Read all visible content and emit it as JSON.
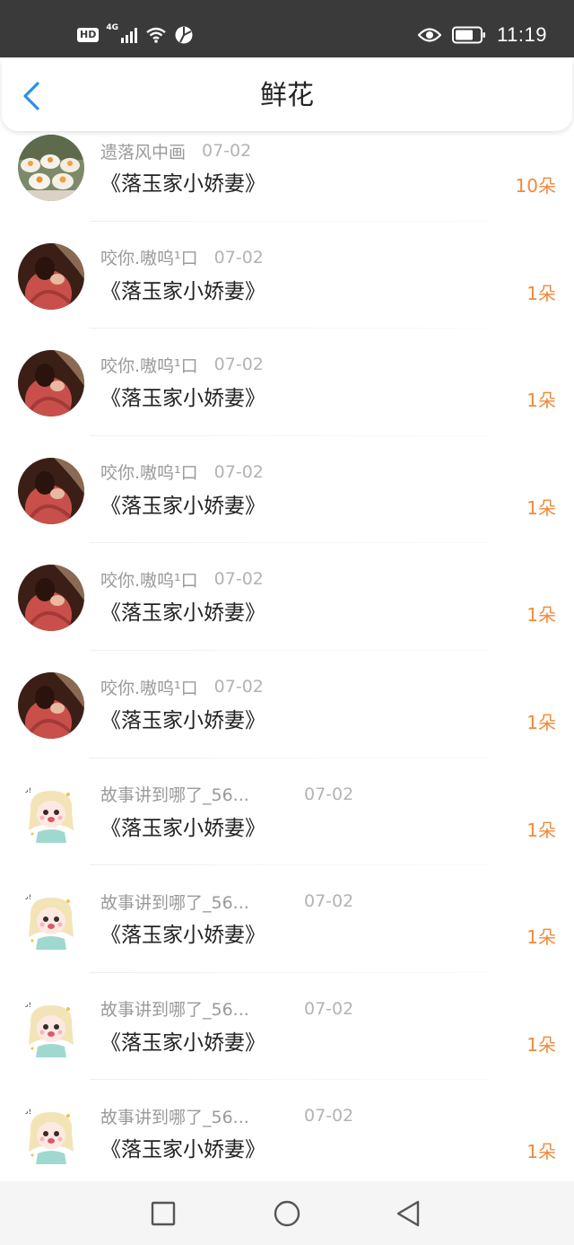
{
  "status_bar": {
    "hd": "HD",
    "network": "4G",
    "time": "11:19"
  },
  "header": {
    "title": "鲜花"
  },
  "icons": {
    "back": "chevron-left-icon",
    "eye": "eye-icon",
    "battery": "battery-icon",
    "wifi": "wifi-icon",
    "signal": "signal-icon",
    "nav_recent": "square-icon",
    "nav_home": "circle-icon",
    "nav_back": "triangle-back-icon"
  },
  "colors": {
    "accent_orange": "#f08a3c",
    "back_blue": "#2b8fe8"
  },
  "rows": [
    {
      "user": "遗落风中画",
      "date": "07-02",
      "book": "《落玉家小娇妻》",
      "count": "10朵",
      "avatar": "sweets"
    },
    {
      "user": "咬你.嗷呜¹口",
      "date": "07-02",
      "book": "《落玉家小娇妻》",
      "count": "1朵",
      "avatar": "red-girl"
    },
    {
      "user": "咬你.嗷呜¹口",
      "date": "07-02",
      "book": "《落玉家小娇妻》",
      "count": "1朵",
      "avatar": "red-girl"
    },
    {
      "user": "咬你.嗷呜¹口",
      "date": "07-02",
      "book": "《落玉家小娇妻》",
      "count": "1朵",
      "avatar": "red-girl"
    },
    {
      "user": "咬你.嗷呜¹口",
      "date": "07-02",
      "book": "《落玉家小娇妻》",
      "count": "1朵",
      "avatar": "red-girl"
    },
    {
      "user": "咬你.嗷呜¹口",
      "date": "07-02",
      "book": "《落玉家小娇妻》",
      "count": "1朵",
      "avatar": "red-girl"
    },
    {
      "user": "故事讲到哪了_56...",
      "date": "07-02",
      "book": "《落玉家小娇妻》",
      "count": "1朵",
      "avatar": "cartoon-girl"
    },
    {
      "user": "故事讲到哪了_56...",
      "date": "07-02",
      "book": "《落玉家小娇妻》",
      "count": "1朵",
      "avatar": "cartoon-girl"
    },
    {
      "user": "故事讲到哪了_56...",
      "date": "07-02",
      "book": "《落玉家小娇妻》",
      "count": "1朵",
      "avatar": "cartoon-girl"
    },
    {
      "user": "故事讲到哪了_56...",
      "date": "07-02",
      "book": "《落玉家小娇妻》",
      "count": "1朵",
      "avatar": "cartoon-girl"
    }
  ]
}
